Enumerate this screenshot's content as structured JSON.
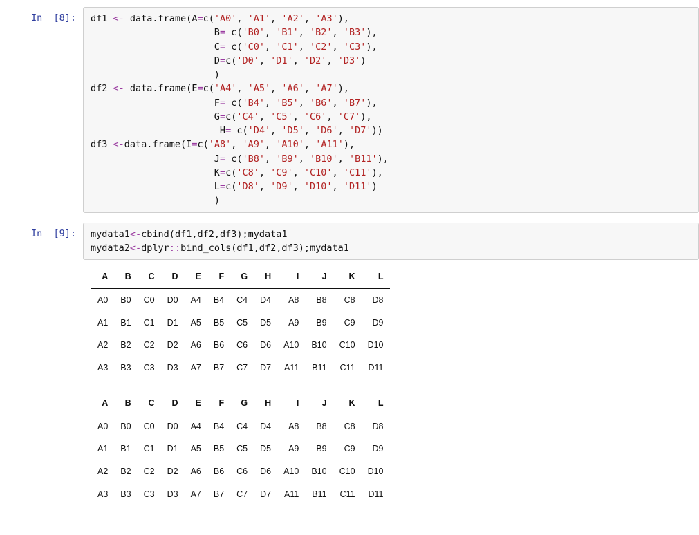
{
  "cells": {
    "c1": {
      "prompt": "In  [8]:"
    },
    "c2": {
      "prompt": "In  [9]:"
    }
  },
  "code1": {
    "t01": "df1 ",
    "op1": "<-",
    "t02": " data.frame(A",
    "op2": "=",
    "t03": "c(",
    "s1": "'A0'",
    "c": ", ",
    "s2": "'A1'",
    "s3": "'A2'",
    "s4": "'A3'",
    "t04": "),",
    "t05": "                      B",
    "op3": "=",
    "t06": " c(",
    "s5": "'B0'",
    "s6": "'B1'",
    "s7": "'B2'",
    "s8": "'B3'",
    "t07": "),",
    "t08": "                      C",
    "op4": "=",
    "t09": " c(",
    "s9": "'C0'",
    "s10": "'C1'",
    "s11": "'C2'",
    "s12": "'C3'",
    "t10": "),",
    "t11": "                      D",
    "op5": "=",
    "t12": "c(",
    "s13": "'D0'",
    "s14": "'D1'",
    "s15": "'D2'",
    "s16": "'D3'",
    "t13": ")",
    "t14": "                      )",
    "t15": "df2 ",
    "op6": "<-",
    "t16": " data.frame(E",
    "op7": "=",
    "t17": "c(",
    "s17": "'A4'",
    "s18": "'A5'",
    "s19": "'A6'",
    "s20": "'A7'",
    "t18": "),",
    "t19": "                      F",
    "op8": "=",
    "t20": " c(",
    "s21": "'B4'",
    "s22": "'B5'",
    "s23": "'B6'",
    "s24": "'B7'",
    "t21": "),",
    "t22": "                      G",
    "op9": "=",
    "t23": "c(",
    "s25": "'C4'",
    "s26": "'C5'",
    "s27": "'C6'",
    "s28": "'C7'",
    "t24": "),",
    "t25": "                       H",
    "op10": "=",
    "t26": " c(",
    "s29": "'D4'",
    "s30": "'D5'",
    "s31": "'D6'",
    "s32": "'D7'",
    "t27": "))",
    "t28": "df3 ",
    "op11": "<-",
    "t29": "data.frame(I",
    "op12": "=",
    "t30": "c(",
    "s33": "'A8'",
    "s34": "'A9'",
    "s35": "'A10'",
    "s36": "'A11'",
    "t31": "),",
    "t32": "                      J",
    "op13": "=",
    "t33": " c(",
    "s37": "'B8'",
    "s38": "'B9'",
    "s39": "'B10'",
    "s40": "'B11'",
    "t34": "),",
    "t35": "                      K",
    "op14": "=",
    "t36": "c(",
    "s41": "'C8'",
    "s42": "'C9'",
    "s43": "'C10'",
    "s44": "'C11'",
    "t37": "),",
    "t38": "                      L",
    "op15": "=",
    "t39": "c(",
    "s45": "'D8'",
    "s46": "'D9'",
    "s47": "'D10'",
    "s48": "'D11'",
    "t40": ")",
    "t41": "                      )"
  },
  "code2": {
    "l1a": "mydata1",
    "op1": "<-",
    "l1b": "cbind(df1,df2,df3);mydata1",
    "l2a": "mydata2",
    "op2": "<-",
    "l2b": "dplyr",
    "dd": "::",
    "l2c": "bind_cols(df1,df2,df3);mydata1"
  },
  "table": {
    "headers": [
      "A",
      "B",
      "C",
      "D",
      "E",
      "F",
      "G",
      "H",
      "I",
      "J",
      "K",
      "L"
    ],
    "rows": [
      [
        "A0",
        "B0",
        "C0",
        "D0",
        "A4",
        "B4",
        "C4",
        "D4",
        "A8",
        "B8",
        "C8",
        "D8"
      ],
      [
        "A1",
        "B1",
        "C1",
        "D1",
        "A5",
        "B5",
        "C5",
        "D5",
        "A9",
        "B9",
        "C9",
        "D9"
      ],
      [
        "A2",
        "B2",
        "C2",
        "D2",
        "A6",
        "B6",
        "C6",
        "D6",
        "A10",
        "B10",
        "C10",
        "D10"
      ],
      [
        "A3",
        "B3",
        "C3",
        "D3",
        "A7",
        "B7",
        "C7",
        "D7",
        "A11",
        "B11",
        "C11",
        "D11"
      ]
    ]
  }
}
